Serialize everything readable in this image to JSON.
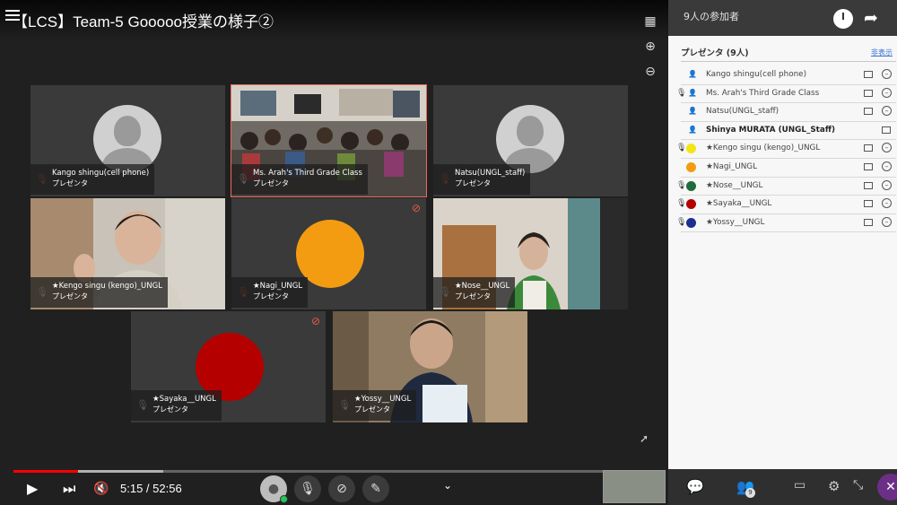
{
  "video": {
    "title": "【LCS】Team-5 Gooooo授業の様子②",
    "time_current": "5:15",
    "time_sep": " / ",
    "time_total": "52:56",
    "progress_fraction": 0.099,
    "buffer_fraction": 0.23
  },
  "colors": {
    "accent_red": "#ff0000",
    "muted_red": "#e8584b",
    "nagi_orange": "#f39c12",
    "sayaka_red": "#b50000",
    "panel_link": "#3a6fd3"
  },
  "tiles": [
    {
      "name": "Kango shingu(cell phone)",
      "role": "プレゼンタ",
      "kind": "avatar",
      "mic": "muted"
    },
    {
      "name": "Ms. Arah's Third Grade Class",
      "role": "プレゼンタ",
      "kind": "classroom",
      "mic": "on",
      "active": true
    },
    {
      "name": "Natsu(UNGL_staff)",
      "role": "プレゼンタ",
      "kind": "avatar",
      "mic": "muted"
    },
    {
      "name": "★Kengo singu (kengo)_UNGL",
      "role": "プレゼンタ",
      "kind": "person",
      "mic": "on"
    },
    {
      "name": "★Nagi_UNGL",
      "role": "プレゼンタ",
      "kind": "orange-circle",
      "mic": "muted",
      "cam_off": true
    },
    {
      "name": "★Nose__UNGL",
      "role": "プレゼンタ",
      "kind": "person2",
      "mic": "on"
    },
    {
      "name": "★Sayaka__UNGL",
      "role": "プレゼンタ",
      "kind": "red-circle",
      "mic": "on",
      "cam_off": true
    },
    {
      "name": "★Yossy__UNGL",
      "role": "プレゼンタ",
      "kind": "person3",
      "mic": "on"
    }
  ],
  "panel": {
    "participant_count": "9人の参加者",
    "section_title": "プレゼンタ (9人)",
    "section_link": "非表示",
    "participants": [
      {
        "name": "Kango shingu(cell phone)",
        "icon": "person-icon",
        "mic": false
      },
      {
        "name": "Ms. Arah's Third Grade Class",
        "icon": "person-icon",
        "mic": true
      },
      {
        "name": "Natsu(UNGL_staff)",
        "icon": "person-icon",
        "mic": false
      },
      {
        "name": "Shinya MURATA (UNGL_Staff)",
        "icon": "person-icon",
        "mic": false,
        "bold": true
      },
      {
        "name": "★Kengo singu (kengo)_UNGL",
        "dot": "#f4e516",
        "mic": true
      },
      {
        "name": "★Nagi_UNGL",
        "dot": "#f39c12",
        "mic": false
      },
      {
        "name": "★Nose__UNGL",
        "dot": "#1f6b3a",
        "mic": true
      },
      {
        "name": "★Sayaka__UNGL",
        "dot": "#b50000",
        "mic": true
      },
      {
        "name": "★Yossy__UNGL",
        "dot": "#1b2f8f",
        "mic": true
      }
    ],
    "people_badge": "9"
  }
}
